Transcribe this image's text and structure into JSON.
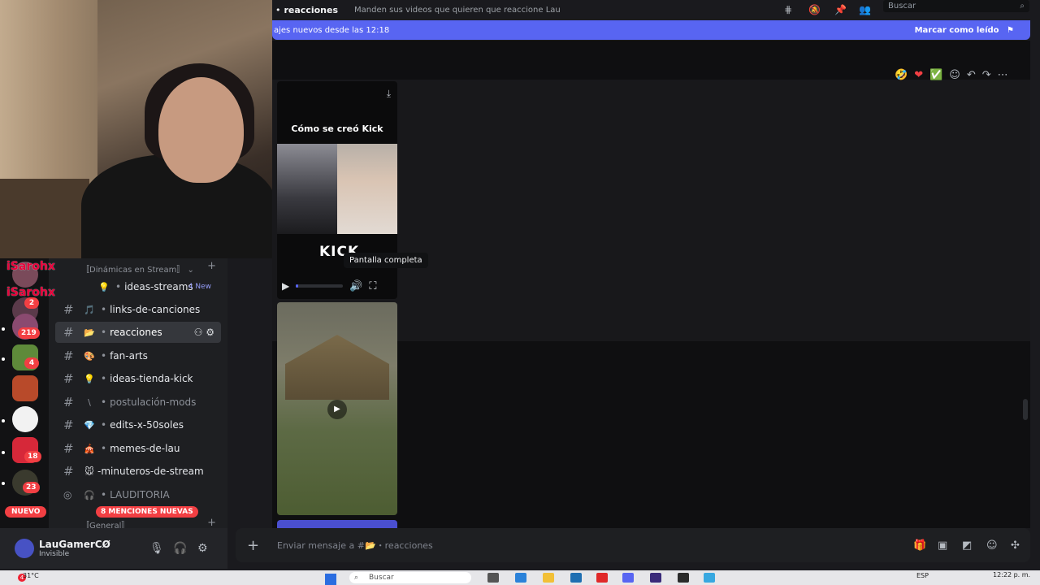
{
  "top_bar": {
    "channel": "reacciones",
    "topic": "Manden sus videos que quieren que reaccione Lau",
    "search_placeholder": "Buscar"
  },
  "new_messages": {
    "text": "ajes nuevos desde las 12:18",
    "mark_read": "Marcar como leído"
  },
  "overlay_users": [
    "iSarohx",
    "iSarohx"
  ],
  "channels": {
    "category_top": "〚Dinámicas en Stream〛",
    "category_general": "〚General〛",
    "items": [
      {
        "emoji": "💡",
        "label": "ideas-streams",
        "badge": "4 New"
      },
      {
        "emoji": "🎵",
        "label": "links-de-canciones"
      },
      {
        "emoji": "📂",
        "label": "reacciones"
      },
      {
        "emoji": "🎨",
        "label": "fan-arts"
      },
      {
        "emoji": "💡",
        "label": "ideas-tienda-kick"
      },
      {
        "emoji": "\\",
        "label": "postulación-mods"
      },
      {
        "emoji": "💎",
        "label": "edits-x-50soles"
      },
      {
        "emoji": "🎪",
        "label": "memes-de-lau"
      },
      {
        "emoji": "🐭",
        "label": "-minuteros-de-stream"
      },
      {
        "emoji": "🎧",
        "label": "LAUDITORIA"
      }
    ],
    "mentions_pill": "8 MENCIONES NUEVAS"
  },
  "servers": {
    "badges": [
      "2",
      "219",
      "4",
      "18",
      "23"
    ],
    "nuevo": "NUEVO"
  },
  "user_bar": {
    "name": "LauGamerCØ",
    "status": "Invisible"
  },
  "video": {
    "title": "Cómo se creó Kick",
    "brand": "KICK",
    "tooltip": "Pantalla completa",
    "progress": 0.05
  },
  "composer": {
    "placeholder": "Enviar mensaje a #📂・reacciones",
    "placeholder_plain": "Enviar mensaje a #",
    "channel": "reacciones"
  },
  "taskbar": {
    "weather": "31°C",
    "weather_badge": "4",
    "search": "Buscar",
    "lang": "ESP",
    "time": "12:22 p. m."
  },
  "colors": {
    "accent": "#5865f2",
    "mention_red": "#f23f43",
    "overlay_name": "#e8003a"
  }
}
